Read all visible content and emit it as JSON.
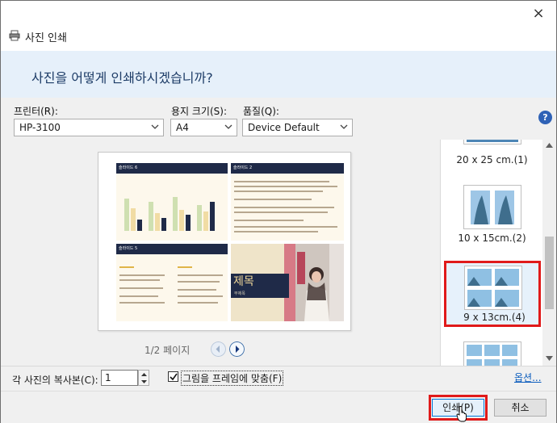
{
  "window": {
    "title": "사진 인쇄",
    "close": "×"
  },
  "header": {
    "question": "사진을 어떻게 인쇄하시겠습니까?"
  },
  "options": {
    "printer_label": "프린터(R):",
    "printer_value": "HP-3100",
    "paper_label": "용지 크기(S):",
    "paper_value": "A4",
    "quality_label": "품질(Q):",
    "quality_value": "Device Default",
    "help": "?"
  },
  "preview": {
    "page_counter": "1/2 페이지",
    "slides": [
      {
        "title": "슬라이드 6"
      },
      {
        "title": "슬라이드 2"
      },
      {
        "title": "슬라이드 5"
      },
      {
        "title": "제목",
        "subtitle": "부제목"
      }
    ]
  },
  "layouts": [
    {
      "label": "20 x 25 cm.(1)"
    },
    {
      "label": "10 x 15cm.(2)"
    },
    {
      "label": "9 x 13cm.(4)"
    }
  ],
  "footer": {
    "copies_label": "각 사진의 복사본(C):",
    "copies_value": "1",
    "fit_label": "그림을 프레임에 맞춤(F)",
    "options_link": "옵션..."
  },
  "buttons": {
    "print": "인쇄(P)",
    "cancel": "취소"
  },
  "colors": {
    "highlight": "#e01a1a",
    "header_band": "#e6f0fa",
    "slide_bar": "#1f2a48"
  }
}
